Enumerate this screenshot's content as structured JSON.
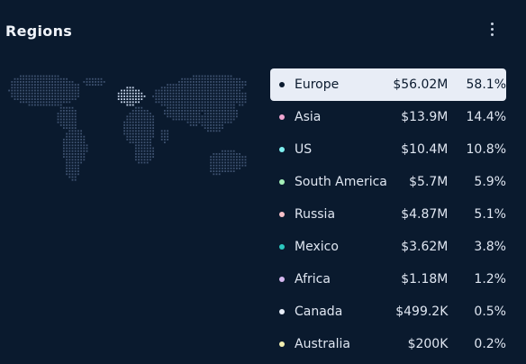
{
  "header": {
    "title": "Regions",
    "menu_icon": "more-vertical-icon"
  },
  "map": {
    "icon": "world-dot-map",
    "highlighted_region": "Europe"
  },
  "regions": [
    {
      "name": "Europe",
      "value": "$56.02M",
      "share": "58.1%",
      "color": "#0a1a2e",
      "selected": true
    },
    {
      "name": "Asia",
      "value": "$13.9M",
      "share": "14.4%",
      "color": "#f0a6d2"
    },
    {
      "name": "US",
      "value": "$10.4M",
      "share": "10.8%",
      "color": "#7ff0f0"
    },
    {
      "name": "South America",
      "value": "$5.7M",
      "share": "5.9%",
      "color": "#a5f0b8"
    },
    {
      "name": "Russia",
      "value": "$4.87M",
      "share": "5.1%",
      "color": "#f7c0c8"
    },
    {
      "name": "Mexico",
      "value": "$3.62M",
      "share": "3.8%",
      "color": "#2cc8c0"
    },
    {
      "name": "Africa",
      "value": "$1.18M",
      "share": "1.2%",
      "color": "#d6b8f0"
    },
    {
      "name": "Canada",
      "value": "$499.2K",
      "share": "0.5%",
      "color": "#e8eef8"
    },
    {
      "name": "Australia",
      "value": "$200K",
      "share": "0.2%",
      "color": "#f2eeb0"
    }
  ]
}
